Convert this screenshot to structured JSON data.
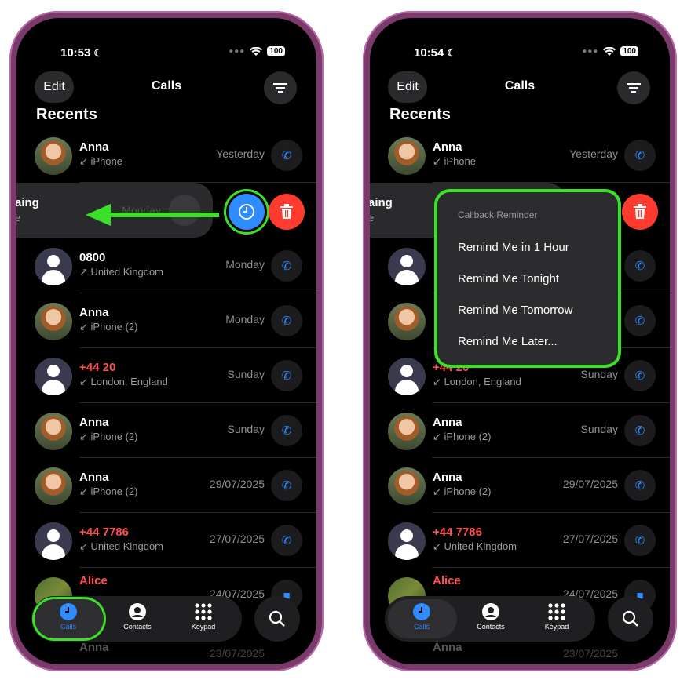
{
  "colors": {
    "accent": "#2e8cff",
    "missed": "#ff4d4d",
    "highlight": "#3be029",
    "delete": "#ff3b30"
  },
  "left": {
    "time": "10:53",
    "battery": "100",
    "header": {
      "edit": "Edit",
      "title": "Calls"
    },
    "section": "Recents",
    "swiped": {
      "name": "aing",
      "sub": "e",
      "date": "Monday"
    },
    "rows": [
      {
        "name": "Anna",
        "sub": "↙ iPhone",
        "date": "Yesterday"
      },
      {
        "name": "0800",
        "sub": "↗ United Kingdom",
        "date": "Monday"
      },
      {
        "name": "Anna",
        "sub": "↙ iPhone (2)",
        "date": "Monday"
      },
      {
        "name": "+44 20",
        "sub": "↙ London, England",
        "date": "Sunday"
      },
      {
        "name": "Anna",
        "sub": "↙ iPhone (2)",
        "date": "Sunday"
      },
      {
        "name": "Anna",
        "sub": "↙ iPhone (2)",
        "date": "29/07/2025"
      },
      {
        "name": "+44 7786",
        "sub": "↙ United Kingdom",
        "date": "27/07/2025"
      },
      {
        "name": "Alice",
        "sub": "",
        "date": "24/07/2025"
      }
    ],
    "partial": {
      "name": "Anna",
      "date": "23/07/2025"
    },
    "tabs": {
      "calls": "Calls",
      "contacts": "Contacts",
      "keypad": "Keypad"
    }
  },
  "right": {
    "time": "10:54",
    "battery": "100",
    "header": {
      "edit": "Edit",
      "title": "Calls"
    },
    "section": "Recents",
    "swiped": {
      "name": "aing",
      "sub": "e"
    },
    "menu": {
      "title": "Callback Reminder",
      "items": [
        "Remind Me in 1 Hour",
        "Remind Me Tonight",
        "Remind Me Tomorrow",
        "Remind Me Later..."
      ]
    },
    "rows": [
      {
        "name": "Anna",
        "sub": "↙ iPhone",
        "date": "Yesterday"
      },
      {
        "name": "",
        "sub": "",
        "date": ""
      },
      {
        "name": "",
        "sub": "",
        "date": ""
      },
      {
        "name": "+44 20",
        "sub": "↙ London, England",
        "date": "Sunday"
      },
      {
        "name": "Anna",
        "sub": "↙ iPhone (2)",
        "date": "Sunday"
      },
      {
        "name": "Anna",
        "sub": "↙ iPhone (2)",
        "date": "29/07/2025"
      },
      {
        "name": "+44 7786",
        "sub": "↙ United Kingdom",
        "date": "27/07/2025"
      },
      {
        "name": "Alice",
        "sub": "",
        "date": "24/07/2025"
      }
    ],
    "partial": {
      "name": "Anna",
      "date": "23/07/2025"
    },
    "tabs": {
      "calls": "Calls",
      "contacts": "Contacts",
      "keypad": "Keypad"
    }
  }
}
